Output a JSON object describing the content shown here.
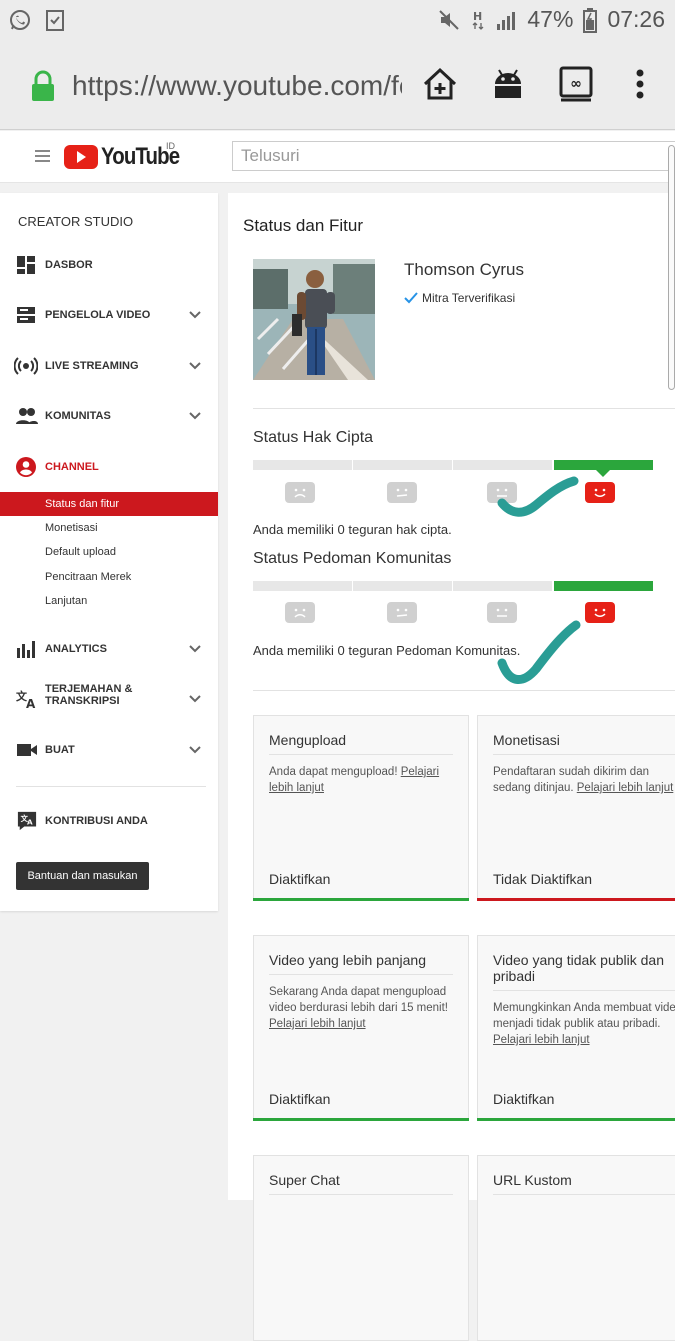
{
  "status_bar": {
    "left_icons": [
      "whatsapp-icon",
      "task-check-icon"
    ],
    "right_icons": [
      "mute-icon",
      "data-h-icon",
      "signal-icon"
    ],
    "battery": "47%",
    "time": "07:26"
  },
  "browser": {
    "url": "https://www.youtube.com/fe",
    "icons": [
      "lock-icon",
      "add-home-icon",
      "android-icon",
      "tab-switcher-icon",
      "more-vert-icon"
    ],
    "accent": "#3ab54a"
  },
  "youtube_header": {
    "logo_text": "YouTube",
    "region": "ID",
    "search_placeholder": "Telusuri",
    "brand_red": "#e62117"
  },
  "sidebar": {
    "title": "CREATOR STUDIO",
    "items": [
      {
        "label": "DASBOR",
        "icon": "dashboard-icon",
        "chevron": false
      },
      {
        "label": "PENGELOLA VIDEO",
        "icon": "video-manager-icon",
        "chevron": true
      },
      {
        "label": "LIVE STREAMING",
        "icon": "live-icon",
        "chevron": true
      },
      {
        "label": "KOMUNITAS",
        "icon": "people-icon",
        "chevron": true
      },
      {
        "label": "CHANNEL",
        "icon": "account-icon",
        "chevron": false,
        "active": true
      }
    ],
    "sub_items": [
      "Status dan fitur",
      "Monetisasi",
      "Default upload",
      "Pencitraan Merek",
      "Lanjutan"
    ],
    "items2": [
      {
        "label": "ANALYTICS",
        "icon": "analytics-icon",
        "chevron": true
      },
      {
        "label": "TERJEMAHAN &",
        "label2": "TRANSKRIPSI",
        "icon": "translate-icon",
        "chevron": true
      },
      {
        "label": "BUAT",
        "icon": "camera-icon",
        "chevron": true
      }
    ],
    "contrib": {
      "label": "KONTRIBUSI ANDA",
      "icon": "translate-bubble-icon"
    },
    "help_button": "Bantuan dan masukan"
  },
  "main": {
    "title": "Status dan Fitur",
    "channel_name": "Thomson Cyrus",
    "verified_label": "Mitra Terverifikasi",
    "copyright": {
      "title": "Status Hak Cipta",
      "text": "Anda memiliki 0 teguran hak cipta.",
      "strikes": 0
    },
    "community": {
      "title": "Status Pedoman Komunitas",
      "text": "Anda memiliki 0 teguran Pedoman Komunitas.",
      "strikes": 0
    },
    "cards": [
      {
        "title": "Mengupload",
        "body": "Anda dapat mengupload! ",
        "link": "Pelajari lebih lanjut",
        "status": "Diaktifkan",
        "enabled": true
      },
      {
        "title": "Monetisasi",
        "body": "Pendaftaran sudah dikirim dan sedang ditinjau. ",
        "link": "Pelajari lebih lanjut",
        "status": "Tidak Diaktifkan",
        "enabled": false
      },
      {
        "title": "Video yang lebih panjang",
        "body": "Sekarang Anda dapat mengupload video berdurasi lebih dari 15 menit! ",
        "link": "Pelajari lebih lanjut",
        "status": "Diaktifkan",
        "enabled": true
      },
      {
        "title": "Video yang tidak publik dan pribadi",
        "body": "Memungkinkan Anda membuat video menjadi tidak publik atau pribadi. ",
        "link": "Pelajari lebih lanjut",
        "status": "Diaktifkan",
        "enabled": true
      },
      {
        "title": "Super Chat"
      },
      {
        "title": "URL Kustom"
      }
    ],
    "annotation_color": "#2a9d95"
  }
}
